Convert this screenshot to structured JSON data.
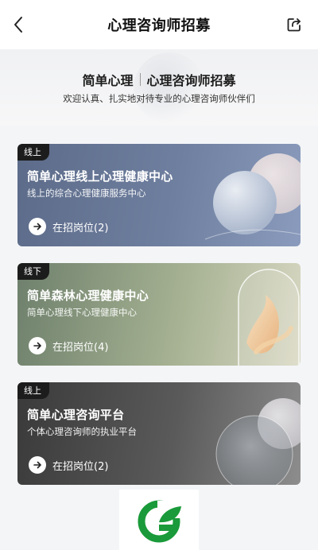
{
  "nav": {
    "title": "心理咨询师招募"
  },
  "header": {
    "brand": "简单心理",
    "title": "心理咨询师招募",
    "subtitle": "欢迎认真、扎实地对待专业的心理咨询师伙伴们"
  },
  "cards": [
    {
      "tag": "线上",
      "title": "简单心理线上心理健康中心",
      "desc": "线上的综合心理健康服务中心",
      "link": "在招岗位(2)"
    },
    {
      "tag": "线下",
      "title": "简单森林心理健康中心",
      "desc": "简单心理线下心理健康中心",
      "link": "在招岗位(4)"
    },
    {
      "tag": "线上",
      "title": "简单心理咨询平台",
      "desc": "个体心理咨询师的执业平台",
      "link": "在招岗位(2)"
    }
  ],
  "colors": {
    "logo_green": "#1a9a3a",
    "tag_bg": "#1c1c1c"
  },
  "icons": {
    "back": "chevron-left-icon",
    "share": "share-icon",
    "arrow": "arrow-right-icon",
    "logo": "leaf-logo-icon"
  }
}
